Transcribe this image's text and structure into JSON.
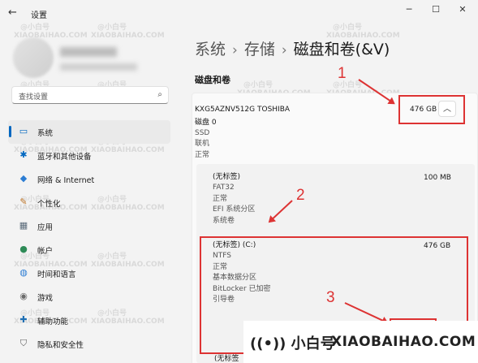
{
  "window": {
    "back_icon": "arrow-left-icon",
    "title": "设置",
    "controls": [
      "─",
      "☐",
      "✕"
    ]
  },
  "search": {
    "placeholder": "查找设置"
  },
  "nav": [
    {
      "label": "系统",
      "icon": "monitor-icon",
      "glyph": "▭",
      "color": "#0067c0",
      "active": true
    },
    {
      "label": "蓝牙和其他设备",
      "icon": "bluetooth-icon",
      "glyph": "✱",
      "color": "#0067c0"
    },
    {
      "label": "网络 & Internet",
      "icon": "wifi-icon",
      "glyph": "◆",
      "color": "#2b7cd3"
    },
    {
      "label": "个性化",
      "icon": "brush-icon",
      "glyph": "✎",
      "color": "#c47a2b"
    },
    {
      "label": "应用",
      "icon": "apps-icon",
      "glyph": "▦",
      "color": "#5a6b7a"
    },
    {
      "label": "帐户",
      "icon": "person-icon",
      "glyph": "●",
      "color": "#2e8b57"
    },
    {
      "label": "时间和语言",
      "icon": "globe-clock-icon",
      "glyph": "◍",
      "color": "#2b7cd3"
    },
    {
      "label": "游戏",
      "icon": "gamepad-icon",
      "glyph": "◉",
      "color": "#6b6b6b"
    },
    {
      "label": "辅助功能",
      "icon": "accessibility-icon",
      "glyph": "✚",
      "color": "#1f6fb3"
    },
    {
      "label": "隐私和安全性",
      "icon": "shield-icon",
      "glyph": "⛉",
      "color": "#5a5a5a"
    }
  ],
  "breadcrumb": {
    "items": [
      "系统",
      "存储",
      "磁盘和卷(&V)"
    ],
    "sep": "›"
  },
  "section_title": "磁盘和卷",
  "disk": {
    "model": "KXG5AZNV512G TOSHIBA",
    "size": "476 GB",
    "expand_icon": "chevron-up-icon",
    "name": "磁盘 0",
    "type": "SSD",
    "status1": "联机",
    "status2": "正常"
  },
  "partitions": [
    {
      "label": "(无标签)",
      "fs": "FAT32",
      "status": "正常",
      "type": "EFI 系统分区",
      "role": "系统卷",
      "size": "100 MB"
    },
    {
      "label": "(无标签) (C:)",
      "fs": "NTFS",
      "status": "正常",
      "type": "基本数据分区",
      "encryption": "BitLocker 已加密",
      "role": "引导卷",
      "size": "476 GB"
    }
  ],
  "partial_next": "(无标签",
  "annotations": [
    "1",
    "2",
    "3"
  ],
  "watermark": {
    "line1": "@小白号",
    "line2": "XIAOBAIHAO.COM"
  },
  "brand": {
    "icon": "broadcast-icon",
    "logo": "((•)) 小白号",
    "text": "XIAOBAIHAO.COM"
  },
  "colors": {
    "accent": "#0067c0",
    "annotation": "#dd3333"
  }
}
